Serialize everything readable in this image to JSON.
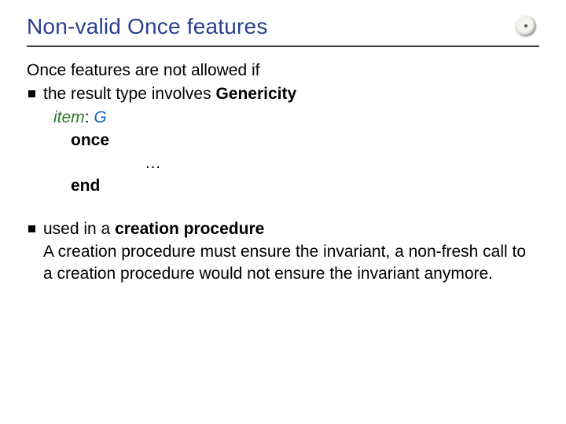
{
  "title": "Non-valid Once features",
  "intro": "Once features are not allowed if",
  "bullets": {
    "b1_pre": "the result type involves ",
    "b1_bold": "Genericity",
    "b2_pre": "used in a ",
    "b2_bold": "creation procedure"
  },
  "code": {
    "ident": "item",
    "colon": ": ",
    "type": "G",
    "once": "once",
    "ellipsis": "…",
    "end": "end"
  },
  "para": "A creation procedure must ensure the invariant, a non-fresh call to a creation procedure would not ensure the invariant anymore."
}
